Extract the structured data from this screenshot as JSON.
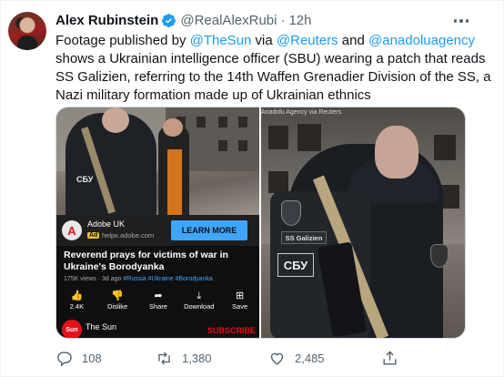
{
  "author": {
    "name": "Alex Rubinstein",
    "handle": "@RealAlexRubi",
    "separator": "·",
    "time": "12h"
  },
  "tweet": {
    "t1": "Footage published by ",
    "m1": "@TheSun",
    "t2": " via ",
    "m2": "@Reuters",
    "t3": " and ",
    "m3": "@anadoluagency",
    "t4": " shows a Ukrainian intelligence officer (SBU) wearing a patch that reads SS Galizien, referring to the 14th Waffen Grenadier Division of the SS, a Nazi military formation made up of Ukrainian ethnics"
  },
  "media_left": {
    "patch_text": "СБУ",
    "ad": {
      "logo_letter": "A",
      "name": "Adobe UK",
      "badge": "Ad",
      "url": "helpx.adobe.com",
      "button": "LEARN MORE"
    },
    "video": {
      "title": "Reverend prays for victims of war in Ukraine's Borodyanka",
      "meta": "175K views · 3d ago ",
      "tags": "#Russia #Ukraine #Borodyanka"
    },
    "actions": [
      {
        "icon": "👍",
        "label": "2.4K"
      },
      {
        "icon": "👎",
        "label": "Dislike"
      },
      {
        "icon": "➦",
        "label": "Share"
      },
      {
        "icon": "⤓",
        "label": "Download"
      },
      {
        "icon": "⊞",
        "label": "Save"
      }
    ],
    "channel": {
      "logo": "Sun",
      "name": "The Sun",
      "subscribe": "SUBSCRIBE"
    }
  },
  "media_right": {
    "watermark": "Anadolu Agency via Reuters",
    "patch_galizien": "SS Galizien",
    "patch_sbu": "СБУ"
  },
  "footer": {
    "replies": "108",
    "retweets": "1,380",
    "likes": "2,485"
  },
  "icons": {
    "verified_color": "#1d9bf0",
    "mention_color": "#1d9bf0",
    "muted_color": "#536471"
  }
}
